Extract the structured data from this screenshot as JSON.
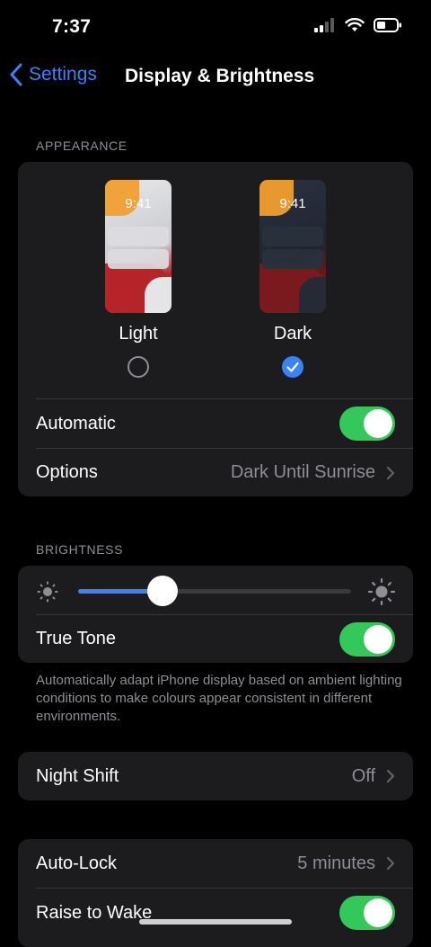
{
  "status": {
    "time": "7:37"
  },
  "nav": {
    "back_label": "Settings",
    "title": "Display & Brightness"
  },
  "appearance": {
    "header": "APPEARANCE",
    "light": {
      "label": "Light",
      "time": "9:41",
      "selected": false
    },
    "dark": {
      "label": "Dark",
      "time": "9:41",
      "selected": true
    },
    "automatic": {
      "label": "Automatic",
      "on": true
    },
    "options": {
      "label": "Options",
      "value": "Dark Until Sunrise"
    }
  },
  "brightness": {
    "header": "BRIGHTNESS",
    "level": 0.31,
    "true_tone": {
      "label": "True Tone",
      "on": true
    },
    "footnote": "Automatically adapt iPhone display based on ambient lighting conditions to make colours appear consistent in different environments."
  },
  "night_shift": {
    "label": "Night Shift",
    "value": "Off"
  },
  "auto_lock": {
    "label": "Auto-Lock",
    "value": "5 minutes"
  },
  "raise_to_wake": {
    "label": "Raise to Wake",
    "on": true
  },
  "colors": {
    "accent": "#3b82f6",
    "toggle_on": "#34c759",
    "group_bg": "#1c1c1e"
  }
}
